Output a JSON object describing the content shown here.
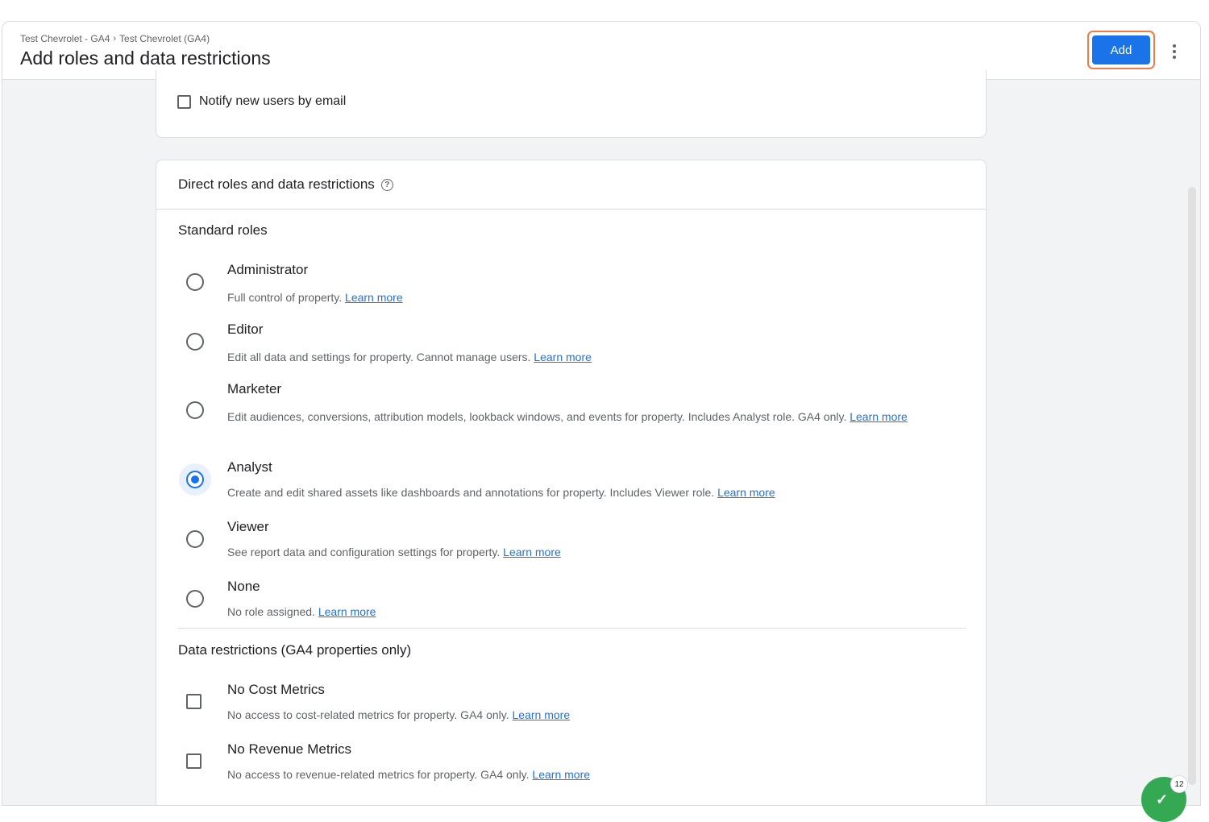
{
  "header": {
    "breadcrumb": [
      "Test Chevrolet - GA4",
      "Test Chevrolet (GA4)"
    ],
    "breadcrumb_separator": "›",
    "title": "Add roles and data restrictions",
    "add_label": "Add"
  },
  "notify": {
    "label": "Notify new users by email",
    "checked": false
  },
  "roles_card": {
    "title": "Direct roles and data restrictions",
    "help_glyph": "?",
    "standard_roles_label": "Standard roles",
    "link_text": "Learn more",
    "roles": [
      {
        "title": "Administrator",
        "desc": "Full control of property.",
        "link": "Learn more",
        "selected": false
      },
      {
        "title": "Editor",
        "desc": "Edit all data and settings for property. Cannot manage users.",
        "link": "Learn more",
        "selected": false
      },
      {
        "title": "Marketer",
        "desc": "Edit audiences, conversions, attribution models, lookback windows, and events for property. Includes Analyst role. GA4 only.",
        "link": "Learn more",
        "selected": false
      },
      {
        "title": "Analyst",
        "desc": "Create and edit shared assets like dashboards and annotations for property. Includes Viewer role.",
        "link": "Learn more",
        "selected": true
      },
      {
        "title": "Viewer",
        "desc": "See report data and configuration settings for property.",
        "link": "Learn more",
        "selected": false
      },
      {
        "title": "None",
        "desc": "No role assigned.",
        "link": "Learn more",
        "selected": false
      }
    ],
    "restrictions_label": "Data restrictions (GA4 properties only)",
    "restrictions": [
      {
        "title": "No Cost Metrics",
        "desc": "No access to cost-related metrics for property. GA4 only.",
        "link": "Learn more",
        "checked": false
      },
      {
        "title": "No Revenue Metrics",
        "desc": "No access to revenue-related metrics for property. GA4 only.",
        "link": "Learn more",
        "checked": false
      }
    ]
  },
  "badge": {
    "count": "12",
    "icon": "check-icon"
  },
  "colors": {
    "accent": "#1a73e8",
    "highlight_outline": "#f07a4a",
    "badge": "#34a853"
  }
}
